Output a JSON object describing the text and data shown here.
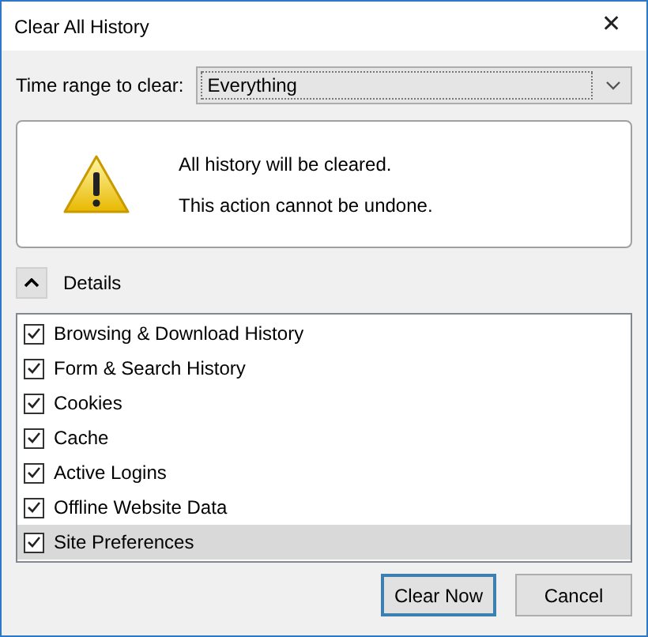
{
  "window": {
    "title": "Clear All History",
    "close": "✕"
  },
  "time_range": {
    "label": "Time range to clear:",
    "value": "Everything"
  },
  "warning": {
    "lines": [
      "All history will be cleared.",
      "This action cannot be undone."
    ]
  },
  "details": {
    "label": "Details",
    "expanded": true
  },
  "items": [
    {
      "label": "Browsing & Download History",
      "checked": true,
      "selected": false
    },
    {
      "label": "Form & Search History",
      "checked": true,
      "selected": false
    },
    {
      "label": "Cookies",
      "checked": true,
      "selected": false
    },
    {
      "label": "Cache",
      "checked": true,
      "selected": false
    },
    {
      "label": "Active Logins",
      "checked": true,
      "selected": false
    },
    {
      "label": "Offline Website Data",
      "checked": true,
      "selected": false
    },
    {
      "label": "Site Preferences",
      "checked": true,
      "selected": true
    }
  ],
  "buttons": [
    {
      "label": "Clear Now",
      "default": true
    },
    {
      "label": "Cancel",
      "default": false
    }
  ]
}
